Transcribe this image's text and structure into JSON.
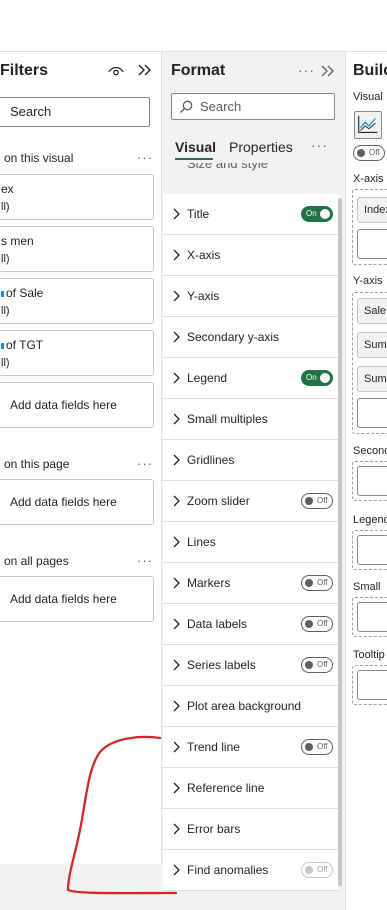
{
  "filters": {
    "title": "Filters",
    "search_placeholder": "Search",
    "section_visual": "on this visual",
    "section_page": "on this page",
    "section_all": "on all pages",
    "more": "···",
    "cards": [
      {
        "name": "ex",
        "value": "ll)"
      },
      {
        "name": "s men",
        "value": "ll)"
      },
      {
        "name": "of Sale",
        "value": "ll)"
      },
      {
        "name": "of TGT",
        "value": "ll)"
      }
    ],
    "add_fields": "Add data fields here"
  },
  "format": {
    "title": "Format",
    "more": "···",
    "search_placeholder": "Search",
    "tabs": [
      "Visual",
      "Properties"
    ],
    "tab_more": "···",
    "cut_row": "Size and style",
    "rows": [
      {
        "label": "Title",
        "toggle": "on"
      },
      {
        "label": "X-axis",
        "toggle": "none"
      },
      {
        "label": "Y-axis",
        "toggle": "none"
      },
      {
        "label": "Secondary y-axis",
        "toggle": "none"
      },
      {
        "label": "Legend",
        "toggle": "on"
      },
      {
        "label": "Small multiples",
        "toggle": "none"
      },
      {
        "label": "Gridlines",
        "toggle": "none"
      },
      {
        "label": "Zoom slider",
        "toggle": "off"
      },
      {
        "label": "Lines",
        "toggle": "none"
      },
      {
        "label": "Markers",
        "toggle": "off"
      },
      {
        "label": "Data labels",
        "toggle": "off"
      },
      {
        "label": "Series labels",
        "toggle": "off"
      },
      {
        "label": "Plot area background",
        "toggle": "none"
      },
      {
        "label": "Trend line",
        "toggle": "off"
      },
      {
        "label": "Reference line",
        "toggle": "none"
      },
      {
        "label": "Error bars",
        "toggle": "none"
      },
      {
        "label": "Find anomalies",
        "toggle": "disabled"
      }
    ],
    "on_text": "On",
    "off_text": "Off"
  },
  "build": {
    "title": "Build",
    "visual_label": "Visual",
    "toggle_text": "Off",
    "xaxis_label": "X-axis",
    "xaxis_field": "Index",
    "yaxis_label": "Y-axis",
    "yaxis_fields": [
      "Sale",
      "Sum",
      "Sum"
    ],
    "secondary_label": "Second",
    "legend_label": "Legend",
    "small_label": "Small",
    "tooltips_label": "Tooltip"
  },
  "colors": {
    "accent_green": "#217346",
    "annotation_red": "#d0272d",
    "field_blue": "#118dff"
  },
  "icons": [
    "eye-icon",
    "double-chevron-right-icon",
    "search-icon",
    "chevron-right-icon",
    "line-chart-icon"
  ]
}
